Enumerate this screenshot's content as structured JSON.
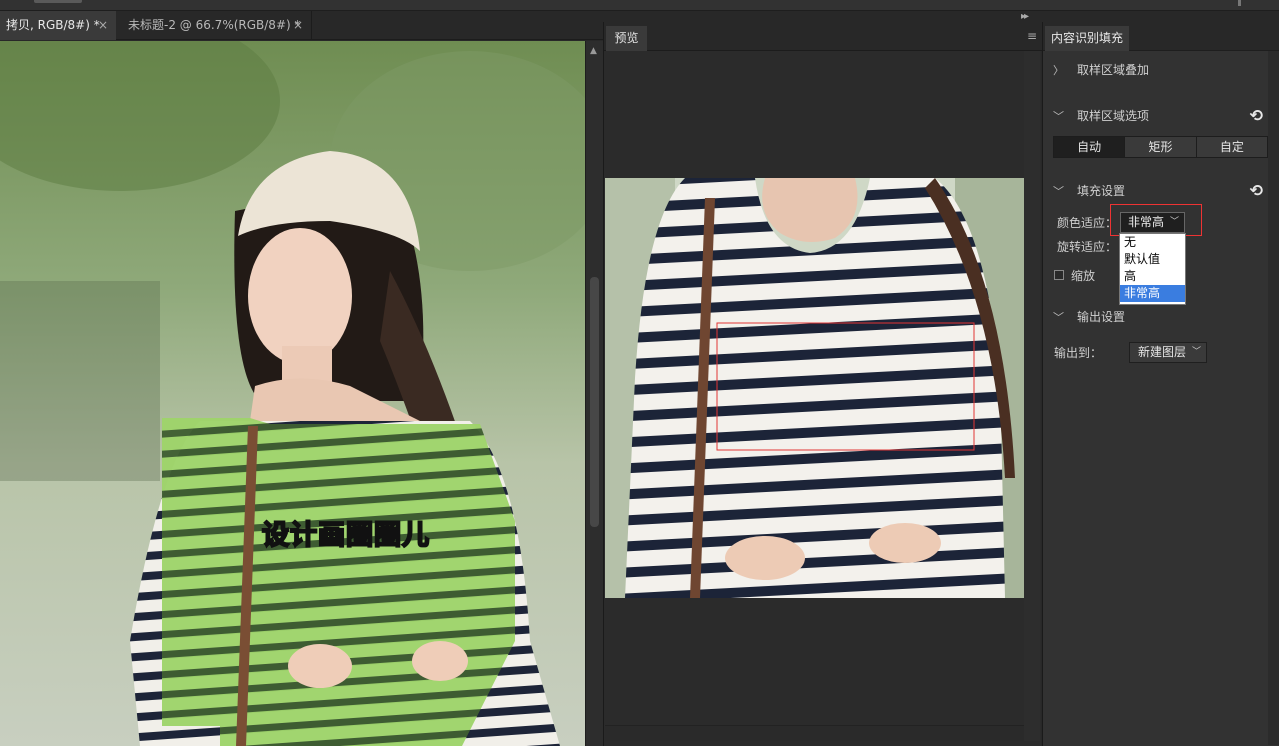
{
  "document_tabs": [
    {
      "label": "拷贝, RGB/8#) *",
      "close": "×"
    },
    {
      "label": "未标题-2 @ 66.7%(RGB/8#) *",
      "close": "×"
    }
  ],
  "preview_panel": {
    "tab_label": "预览"
  },
  "canvas_overlay_text": "设计画圈圈儿",
  "content_aware_panel": {
    "tab_label": "内容识别填充",
    "sections": {
      "sampling_overlay": {
        "label": "取样区域叠加"
      },
      "sampling_options": {
        "label": "取样区域选项",
        "buttons": [
          "自动",
          "矩形",
          "自定"
        ],
        "selected": "自动"
      },
      "fill_settings": {
        "label": "填充设置",
        "color_adaptation_label": "颜色适应：",
        "color_adaptation_value": "非常高",
        "color_adaptation_options": [
          "无",
          "默认值",
          "高",
          "非常高"
        ],
        "rotation_adaptation_label": "旋转适应：",
        "scale_label": "缩放"
      },
      "output_settings": {
        "label": "输出设置",
        "output_to_label": "输出到：",
        "output_to_value": "新建图层"
      }
    }
  },
  "colors": {
    "accent_highlight": "#3a7de0",
    "selection_red": "#e33333",
    "fill_overlay_green": "#9ed46a"
  }
}
